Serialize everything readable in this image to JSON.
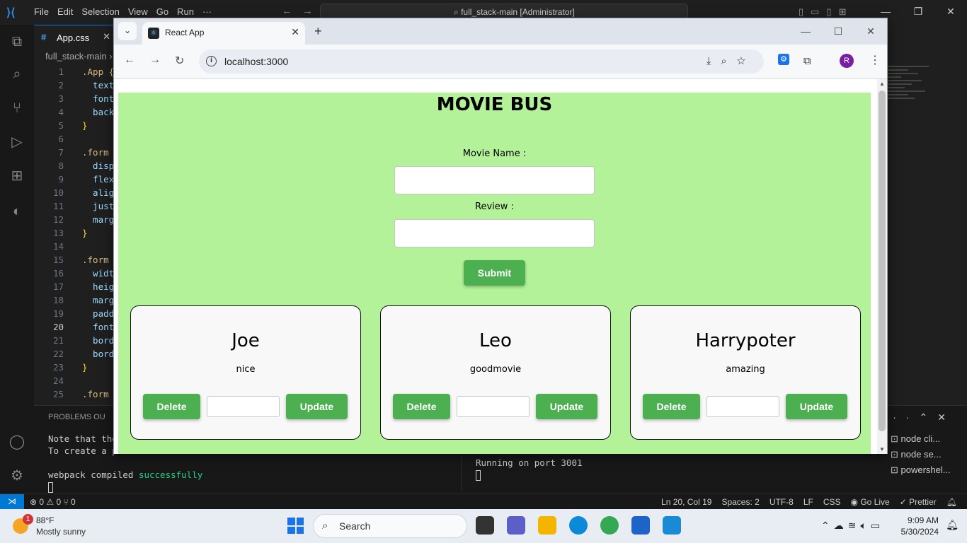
{
  "vscode": {
    "menu": [
      "File",
      "Edit",
      "Selection",
      "View",
      "Go",
      "Run",
      "···"
    ],
    "search_text": "full_stack-main [Administrator]",
    "tab_label": "App.css",
    "breadcrumb": "full_stack-main",
    "code_lines": [
      {
        "n": "1",
        "t": ".App {",
        "kind": "sel"
      },
      {
        "n": "2",
        "t": "  text",
        "kind": "prop"
      },
      {
        "n": "3",
        "t": "  font",
        "kind": "prop"
      },
      {
        "n": "4",
        "t": "  back",
        "kind": "prop"
      },
      {
        "n": "5",
        "t": "}",
        "kind": "br"
      },
      {
        "n": "6",
        "t": "",
        "kind": "prop"
      },
      {
        "n": "7",
        "t": ".form",
        "kind": "sel"
      },
      {
        "n": "8",
        "t": "  disp",
        "kind": "prop"
      },
      {
        "n": "9",
        "t": "  flex",
        "kind": "prop"
      },
      {
        "n": "10",
        "t": "  alig",
        "kind": "prop"
      },
      {
        "n": "11",
        "t": "  just",
        "kind": "prop"
      },
      {
        "n": "12",
        "t": "  marg",
        "kind": "prop"
      },
      {
        "n": "13",
        "t": "}",
        "kind": "br"
      },
      {
        "n": "14",
        "t": "",
        "kind": "prop"
      },
      {
        "n": "15",
        "t": ".form",
        "kind": "sel"
      },
      {
        "n": "16",
        "t": "  widt",
        "kind": "prop"
      },
      {
        "n": "17",
        "t": "  heig",
        "kind": "prop"
      },
      {
        "n": "18",
        "t": "  marg",
        "kind": "prop"
      },
      {
        "n": "19",
        "t": "  padd",
        "kind": "prop"
      },
      {
        "n": "20",
        "t": "  font",
        "kind": "prop"
      },
      {
        "n": "21",
        "t": "  bord",
        "kind": "prop"
      },
      {
        "n": "22",
        "t": "  bord",
        "kind": "prop"
      },
      {
        "n": "23",
        "t": "}",
        "kind": "br"
      },
      {
        "n": "24",
        "t": "",
        "kind": "prop"
      },
      {
        "n": "25",
        "t": ".form",
        "kind": "sel"
      }
    ],
    "active_line": "20",
    "panel": {
      "tabs": "PROBLEMS     OU",
      "terminal_left": [
        "Note that the",
        "To create a p"
      ],
      "webpack_prefix": "webpack compiled ",
      "webpack_ok": "successfully",
      "terminal_right": "Running on port 3001",
      "terminal_list": [
        "node cli...",
        "node se...",
        "powershel..."
      ]
    },
    "status": {
      "left": "⊗ 0 ⚠ 0   ⑂ 0",
      "position": "Ln 20, Col 19",
      "spaces": "Spaces: 2",
      "encoding": "UTF-8",
      "eol": "LF",
      "language": "CSS",
      "golive": "Go Live",
      "prettier": "Prettier"
    }
  },
  "browser": {
    "tab_title": "React App",
    "url": "localhost:3000",
    "avatar_letter": "R"
  },
  "app": {
    "title": "MOVIE BUS",
    "movie_label": "Movie Name :",
    "review_label": "Review :",
    "submit_label": "Submit",
    "delete_label": "Delete",
    "update_label": "Update",
    "cards": [
      {
        "name": "Joe",
        "review": "nice"
      },
      {
        "name": "Leo",
        "review": "goodmovie"
      },
      {
        "name": "Harrypoter",
        "review": "amazing"
      }
    ]
  },
  "taskbar": {
    "weather_badge": "1",
    "temperature": "88°F",
    "condition": "Mostly sunny",
    "search_label": "Search",
    "time": "9:09 AM",
    "date": "5/30/2024"
  },
  "colors": {
    "app_background": "#b4f29a",
    "button_green": "#4caf50",
    "vscode_accent": "#0078d4"
  }
}
